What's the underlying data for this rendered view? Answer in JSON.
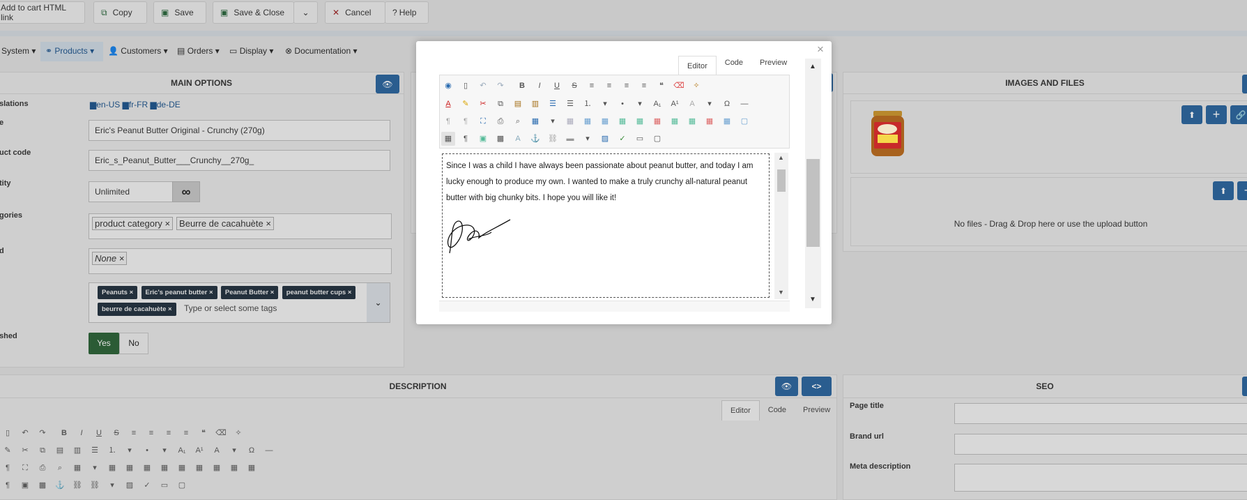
{
  "toolbar": {
    "add_to_cart": "Add to cart HTML link",
    "copy": "Copy",
    "save": "Save",
    "save_close": "Save & Close",
    "cancel": "Cancel",
    "help": "Help"
  },
  "menu": [
    "System",
    "Products",
    "Customers",
    "Orders",
    "Display",
    "Documentation"
  ],
  "main_options": {
    "title": "MAIN OPTIONS",
    "labels": {
      "translations": "slations",
      "name": "e",
      "product_code": "uct code",
      "quantity": "tity",
      "categories": "gories",
      "manufacturer": "d",
      "published": "shed"
    },
    "languages": [
      "en-US",
      "fr-FR",
      "de-DE"
    ],
    "name_value": "Eric's Peanut Butter Original - Crunchy (270g)",
    "code_value": "Eric_s_Peanut_Butter___Crunchy__270g_",
    "quantity_value": "Unlimited",
    "categories": [
      "product category ×",
      "Beurre de cacahuète ×"
    ],
    "manufacturer": "None ×",
    "tags": [
      "Peanuts ×",
      "Eric's peanut butter ×",
      "Peanut Butter ×",
      "peanut butter cups ×",
      "beurre de cacahuète ×"
    ],
    "tags_placeholder": "Type or select some tags",
    "yes": "Yes",
    "no": "No"
  },
  "images": {
    "title": "IMAGES AND FILES",
    "drop_text": "No files - Drag & Drop here or use the upload button"
  },
  "description": {
    "title": "DESCRIPTION",
    "tabs": [
      "Editor",
      "Code",
      "Preview"
    ]
  },
  "seo": {
    "title": "SEO",
    "page_title": "Page title",
    "brand_url": "Brand url",
    "meta_description": "Meta description"
  },
  "modal": {
    "close": "×",
    "tabs": [
      "Editor",
      "Code",
      "Preview"
    ],
    "text": "Since I was a child I have always been passionate about peanut butter, and today I am lucky enough to produce my own. I wanted to make a truly crunchy all-natural peanut butter with big chunky bits. I hope you will like it!"
  },
  "colors": {
    "accent_blue": "#2a5d8f",
    "yes_green": "#2b5b35",
    "tag_dark": "#23303c"
  }
}
